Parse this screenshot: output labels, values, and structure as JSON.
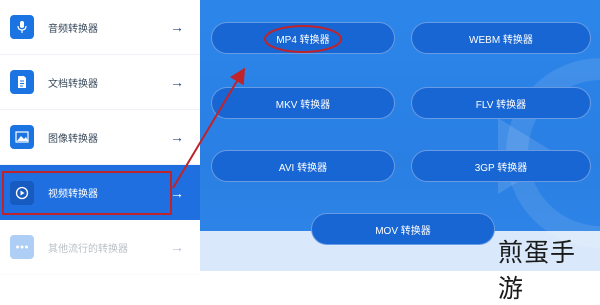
{
  "sidebar": {
    "items": [
      {
        "label": "音频转换器",
        "icon": "microphone-icon"
      },
      {
        "label": "文档转换器",
        "icon": "document-icon"
      },
      {
        "label": "图像转换器",
        "icon": "image-icon"
      },
      {
        "label": "视频转换器",
        "icon": "play-circle-icon"
      },
      {
        "label": "其他流行的转换器",
        "icon": "more-dots-icon"
      }
    ],
    "arrow_glyph": "→"
  },
  "converters": {
    "mp4": "MP4 转换器",
    "webm": "WEBM 转换器",
    "mkv": "MKV 转换器",
    "flv": "FLV 转换器",
    "avi": "AVI 转换器",
    "3gp": "3GP 转换器",
    "mov": "MOV 转换器"
  },
  "watermark": "煎蛋手游",
  "colors": {
    "accent": "#1f6fe0",
    "annotation": "#c0232a"
  }
}
